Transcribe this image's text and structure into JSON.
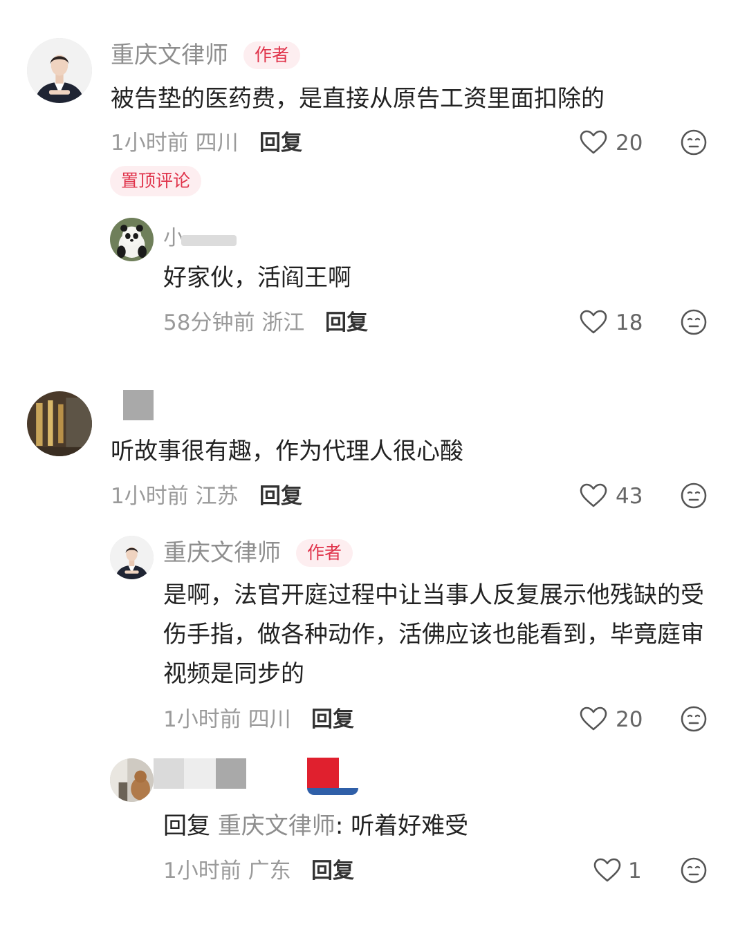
{
  "colors": {
    "accent": "#e0344b",
    "badge_bg": "#fdeef0",
    "meta": "#9a9a9a"
  },
  "icons": {
    "like": "heart-outline-icon",
    "dislike": "meh-face-icon"
  },
  "comments": [
    {
      "author": "重庆文律师",
      "badge": "作者",
      "text": "被告垫的医药费，是直接从原告工资里面扣除的",
      "time": "1小时前",
      "location": "四川",
      "reply": "回复",
      "likes": "20",
      "pinned": "置顶评论"
    },
    {
      "author": "小",
      "text": "好家伙，活阎王啊",
      "time": "58分钟前",
      "location": "浙江",
      "reply": "回复",
      "likes": "18"
    },
    {
      "text": "听故事很有趣，作为代理人很心酸",
      "time": "1小时前",
      "location": "江苏",
      "reply": "回复",
      "likes": "43"
    },
    {
      "author": "重庆文律师",
      "badge": "作者",
      "text": "是啊，法官开庭过程中让当事人反复展示他残缺的受伤手指，做各种动作，活佛应该也能看到，毕竟庭审视频是同步的",
      "time": "1小时前",
      "location": "四川",
      "reply": "回复",
      "likes": "20"
    },
    {
      "reply_prefix": "回复",
      "reply_to": "重庆文律师",
      "colon": ":",
      "text": "听着好难受",
      "time": "1小时前",
      "location": "广东",
      "reply": "回复",
      "likes": "1"
    }
  ]
}
